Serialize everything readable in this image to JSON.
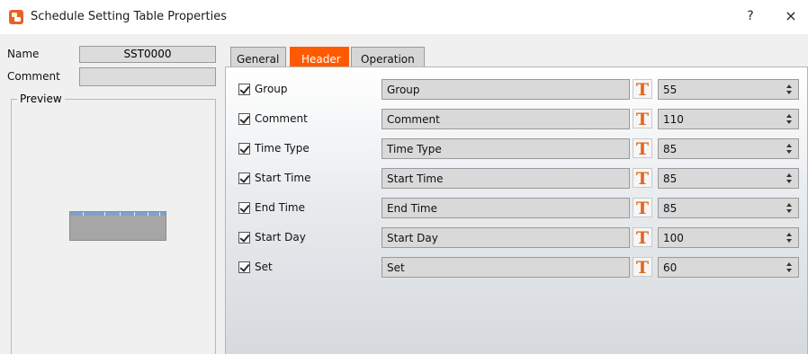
{
  "window": {
    "title": "Schedule Setting Table Properties",
    "help_label": "?",
    "close_label": "×"
  },
  "left": {
    "name_label": "Name",
    "name_value": "SST0000",
    "comment_label": "Comment",
    "comment_value": "",
    "preview_label": "Preview"
  },
  "tabs": [
    {
      "label": "General",
      "active": false
    },
    {
      "label": "Header",
      "active": true
    },
    {
      "label": "Operation",
      "active": false
    }
  ],
  "rows": [
    {
      "label": "Group",
      "checked": true,
      "text": "Group",
      "width": "55"
    },
    {
      "label": "Comment",
      "checked": true,
      "text": "Comment",
      "width": "110"
    },
    {
      "label": "Time Type",
      "checked": true,
      "text": "Time Type",
      "width": "85"
    },
    {
      "label": "Start Time",
      "checked": true,
      "text": "Start Time",
      "width": "85"
    },
    {
      "label": "End Time",
      "checked": true,
      "text": "End Time",
      "width": "85"
    },
    {
      "label": "Start Day",
      "checked": true,
      "text": "Start Day",
      "width": "100"
    },
    {
      "label": "Set",
      "checked": true,
      "text": "Set",
      "width": "60"
    }
  ],
  "icons": {
    "text_style": "T"
  },
  "colors": {
    "active_tab": "#ff5a00",
    "text_icon": "#e2661d"
  }
}
